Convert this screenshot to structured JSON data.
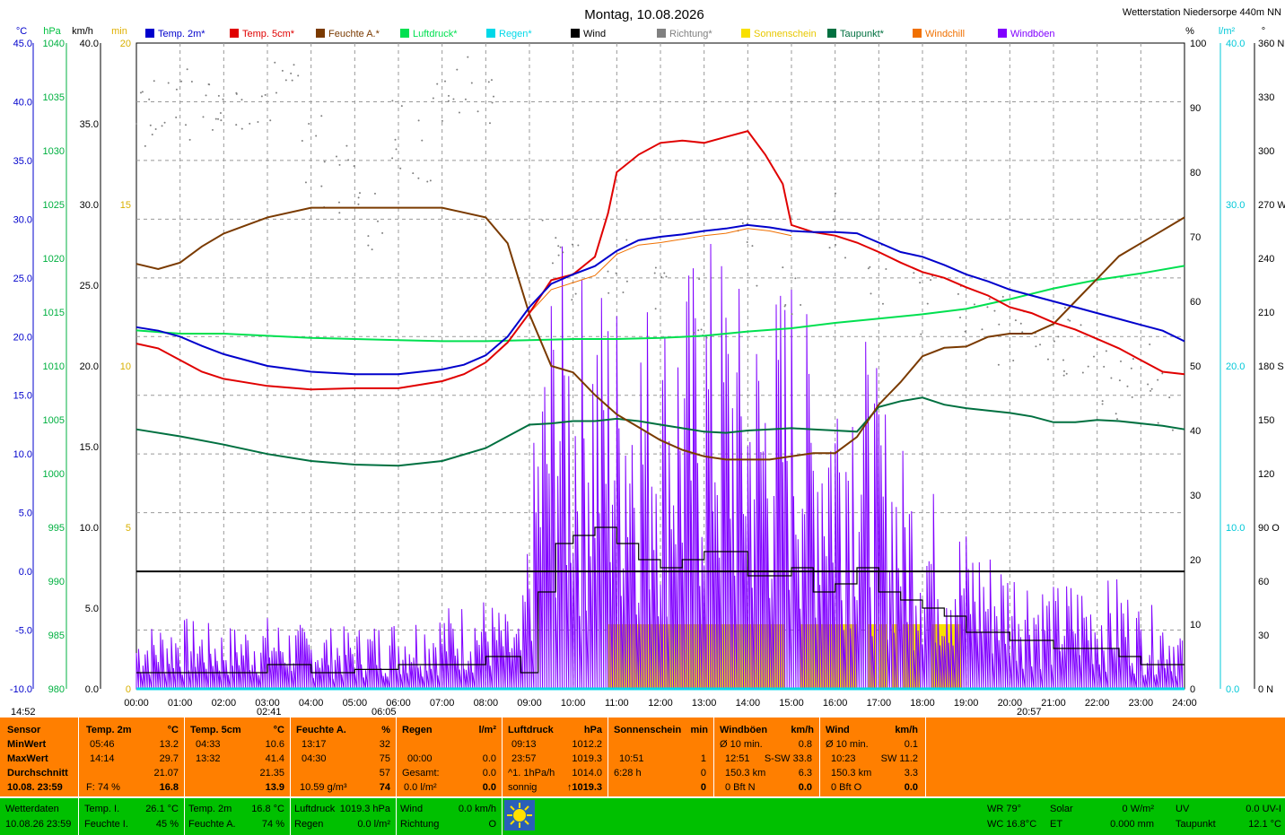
{
  "window": {
    "title": "Montag, 10.08.2026",
    "station": "Wetterstation Niedersorpe 440m NN"
  },
  "axis_units": {
    "temp": "°C",
    "hpa": "hPa",
    "kmh": "km/h",
    "min": "min",
    "pct": "%",
    "lm2": "l/m²",
    "deg": "°"
  },
  "legend": [
    {
      "label": "Temp. 2m*",
      "color": "#0000cc"
    },
    {
      "label": "Temp. 5cm*",
      "color": "#e00000"
    },
    {
      "label": "Feuchte A.*",
      "color": "#7a3a00"
    },
    {
      "label": "Luftdruck*",
      "color": "#00e050"
    },
    {
      "label": "Regen*",
      "color": "#00d8e8"
    },
    {
      "label": "Wind",
      "color": "#000000"
    },
    {
      "label": "Richtung*",
      "color": "#808080"
    },
    {
      "label": "Sonnenschein",
      "color": "#f8e000"
    },
    {
      "label": "Taupunkt*",
      "color": "#007040"
    },
    {
      "label": "Windchill",
      "color": "#f07000"
    },
    {
      "label": "Windböen",
      "color": "#8000ff"
    }
  ],
  "chart_data": {
    "type": "line",
    "title": "Montag, 10.08.2026",
    "x_ticks": [
      "00:00",
      "01:00",
      "02:00",
      "03:00",
      "04:00",
      "05:00",
      "06:00",
      "07:00",
      "08:00",
      "09:00",
      "10:00",
      "11:00",
      "12:00",
      "13:00",
      "14:00",
      "15:00",
      "16:00",
      "17:00",
      "18:00",
      "19:00",
      "20:00",
      "21:00",
      "22:00",
      "23:00",
      "24:00"
    ],
    "x_range_hours": [
      0,
      24
    ],
    "axes": {
      "temp_c": {
        "range": [
          -10,
          45
        ],
        "ticks": [
          "45.0",
          "40.0",
          "35.0",
          "30.0",
          "25.0",
          "20.0",
          "15.0",
          "10.0",
          "5.0",
          "0.0",
          "-5.0",
          "-10.0"
        ]
      },
      "pressure_hpa": {
        "range": [
          980,
          1040
        ],
        "ticks": [
          "1040",
          "1035",
          "1030",
          "1025",
          "1020",
          "1015",
          "1010",
          "1005",
          "1000",
          "995",
          "990",
          "985",
          "980"
        ]
      },
      "wind_kmh": {
        "range": [
          0,
          40
        ],
        "ticks": [
          "40.0",
          "35.0",
          "30.0",
          "25.0",
          "20.0",
          "15.0",
          "10.0",
          "5.0",
          "0.0"
        ]
      },
      "sun_min": {
        "range": [
          0,
          20
        ],
        "ticks": [
          "20",
          "15",
          "10",
          "5",
          "0"
        ]
      },
      "humidity_pct": {
        "range": [
          0,
          100
        ],
        "ticks": [
          "100",
          "90",
          "80",
          "70",
          "60",
          "50",
          "40",
          "30",
          "20",
          "10",
          "0"
        ]
      },
      "rain_lm2": {
        "range": [
          0,
          40
        ],
        "ticks": [
          "40.0",
          "30.0",
          "20.0",
          "10.0",
          "0.0"
        ]
      },
      "direction_deg": {
        "range": [
          0,
          360
        ],
        "ticks": [
          "360 N",
          "330",
          "300",
          "270 W",
          "240",
          "210",
          "180 S",
          "150",
          "120",
          "90 O",
          "60",
          "30",
          "0 N"
        ]
      }
    },
    "grid": true,
    "legend_position": "top",
    "series": [
      {
        "name": "Temp. 2m*",
        "axis": "temp_c",
        "x": [
          0,
          0.5,
          1,
          1.5,
          2,
          3,
          4,
          5,
          6,
          7,
          7.5,
          8,
          8.5,
          9,
          9.5,
          10,
          10.5,
          11,
          11.5,
          12,
          12.5,
          13,
          13.5,
          14,
          14.5,
          15,
          15.5,
          16,
          16.5,
          17,
          17.5,
          18,
          18.5,
          19,
          19.5,
          20,
          20.5,
          21,
          21.5,
          22,
          22.5,
          23,
          23.5,
          24
        ],
        "y": [
          20.8,
          20.5,
          20.0,
          19.2,
          18.5,
          17.5,
          17.0,
          16.8,
          16.8,
          17.2,
          17.6,
          18.4,
          20.0,
          22.5,
          24.5,
          25.3,
          26.0,
          27.3,
          28.2,
          28.5,
          28.7,
          29.0,
          29.2,
          29.5,
          29.3,
          29.0,
          28.9,
          28.9,
          28.8,
          28.0,
          27.2,
          26.8,
          26.1,
          25.3,
          24.7,
          24.0,
          23.5,
          23.0,
          22.5,
          22.0,
          21.5,
          21.0,
          20.5,
          19.6
        ]
      },
      {
        "name": "Temp. 5cm*",
        "axis": "temp_c",
        "x": [
          0,
          0.5,
          1,
          1.5,
          2,
          3,
          4,
          5,
          6,
          7,
          7.5,
          8,
          8.5,
          9,
          9.5,
          10,
          10.5,
          10.8,
          11,
          11.5,
          12,
          12.5,
          13,
          13.5,
          14,
          14.4,
          14.8,
          15,
          15.5,
          16,
          16.5,
          17,
          17.5,
          18,
          18.5,
          19,
          19.5,
          20,
          20.5,
          21,
          21.5,
          22,
          22.5,
          23,
          23.5,
          24
        ],
        "y": [
          19.4,
          19.0,
          18.0,
          17.0,
          16.4,
          15.8,
          15.5,
          15.6,
          15.6,
          16.2,
          16.8,
          17.8,
          19.5,
          22.0,
          24.8,
          25.3,
          26.8,
          30.5,
          34.0,
          35.5,
          36.5,
          36.7,
          36.5,
          37.0,
          37.5,
          35.5,
          33.0,
          29.5,
          28.9,
          28.6,
          28.0,
          27.2,
          26.3,
          25.5,
          25.0,
          24.2,
          23.5,
          22.5,
          22.0,
          21.2,
          20.6,
          19.8,
          19.0,
          18.0,
          17.0,
          16.8
        ]
      },
      {
        "name": "Feuchte A.*",
        "axis": "humidity_pct",
        "x": [
          0,
          0.5,
          1,
          1.5,
          2,
          3,
          4,
          5,
          6,
          7,
          8,
          8.5,
          9,
          9.5,
          10,
          10.5,
          11,
          11.5,
          12,
          12.5,
          13,
          13.5,
          14,
          14.5,
          15,
          15.5,
          16,
          16.5,
          17,
          17.5,
          18,
          18.5,
          19,
          19.5,
          20,
          20.5,
          21,
          21.5,
          22,
          22.5,
          23,
          23.5,
          24
        ],
        "y": [
          65.8,
          65.0,
          66.0,
          68.5,
          70.5,
          73.0,
          74.5,
          74.5,
          74.5,
          74.5,
          73.0,
          69.0,
          58.0,
          50.0,
          49.0,
          45.5,
          42.5,
          40.5,
          38.5,
          37.0,
          36.0,
          35.5,
          35.5,
          35.5,
          36.0,
          36.5,
          36.5,
          39.0,
          44.0,
          47.5,
          51.5,
          52.8,
          53.0,
          54.5,
          55.0,
          55.0,
          56.5,
          60.0,
          63.5,
          67.0,
          69.0,
          71.0,
          73.0
        ]
      },
      {
        "name": "Luftdruck*",
        "axis": "pressure_hpa",
        "x": [
          0,
          1,
          2,
          3,
          4,
          5,
          6,
          7,
          8,
          9,
          10,
          11,
          12,
          13,
          14,
          15,
          16,
          17,
          18,
          19,
          20,
          21,
          22,
          23,
          24
        ],
        "y": [
          1013.3,
          1013.0,
          1013.0,
          1012.8,
          1012.6,
          1012.5,
          1012.4,
          1012.3,
          1012.3,
          1012.4,
          1012.5,
          1012.5,
          1012.6,
          1012.8,
          1013.2,
          1013.5,
          1014.0,
          1014.4,
          1014.8,
          1015.3,
          1016.2,
          1017.2,
          1018.0,
          1018.6,
          1019.3
        ]
      },
      {
        "name": "Taupunkt*",
        "axis": "temp_c",
        "x": [
          0,
          1,
          2,
          3,
          4,
          5,
          6,
          7,
          8,
          8.5,
          9,
          9.5,
          10,
          10.5,
          11,
          11.5,
          12,
          12.5,
          13,
          13.5,
          14,
          14.5,
          15,
          15.5,
          16,
          16.5,
          17,
          17.5,
          18,
          18.5,
          19,
          19.5,
          20,
          20.5,
          21,
          21.5,
          22,
          22.5,
          23,
          23.5,
          24
        ],
        "y": [
          12.1,
          11.5,
          10.8,
          10.0,
          9.4,
          9.1,
          9.0,
          9.4,
          10.5,
          11.5,
          12.5,
          12.6,
          12.8,
          12.8,
          13.0,
          12.8,
          12.5,
          12.2,
          11.9,
          11.8,
          12.0,
          12.1,
          12.2,
          12.1,
          12.0,
          11.9,
          14.0,
          14.5,
          14.8,
          14.2,
          13.9,
          13.7,
          13.5,
          13.2,
          12.7,
          12.7,
          12.9,
          12.8,
          12.6,
          12.4,
          12.1
        ]
      },
      {
        "name": "Windchill",
        "axis": "temp_c",
        "x": [
          9,
          9.5,
          10,
          10.5,
          11,
          11.5,
          12,
          12.5,
          13,
          13.5,
          14,
          14.5,
          15
        ],
        "y": [
          22.0,
          24.0,
          24.6,
          25.2,
          27.0,
          27.8,
          28.0,
          28.3,
          28.6,
          28.8,
          29.2,
          29.0,
          28.6
        ]
      },
      {
        "name": "Wind",
        "axis": "wind_kmh",
        "x": [
          0,
          1,
          2,
          3,
          4,
          5,
          6,
          7,
          8,
          8.8,
          9.2,
          9.6,
          10,
          10.5,
          11,
          11.5,
          12,
          12.5,
          13,
          13.5,
          14,
          14.5,
          15,
          15.5,
          16,
          16.5,
          17,
          17.5,
          18,
          18.5,
          19,
          19.5,
          20,
          20.5,
          21,
          21.5,
          22,
          22.5,
          23,
          23.5,
          24
        ],
        "y": [
          1.0,
          1.0,
          1.0,
          1.5,
          1.0,
          1.2,
          1.5,
          1.5,
          2.0,
          1.0,
          6.0,
          9.0,
          9.5,
          10.0,
          9.0,
          8.0,
          7.5,
          8.0,
          8.5,
          8.5,
          7.0,
          7.0,
          7.5,
          6.0,
          6.5,
          7.5,
          6.0,
          5.5,
          5.0,
          4.5,
          3.5,
          3.5,
          3.0,
          3.0,
          2.5,
          2.5,
          2.5,
          2.0,
          1.5,
          1.5,
          1.5
        ]
      },
      {
        "name": "Windböen",
        "axis": "wind_kmh",
        "x": [
          0,
          1,
          2,
          3,
          4,
          5,
          6,
          7,
          8,
          8.8,
          9.2,
          9.6,
          10,
          10.5,
          11,
          11.5,
          12,
          12.5,
          13,
          13.5,
          14,
          14.5,
          15,
          15.5,
          16,
          16.5,
          17,
          17.5,
          18,
          18.5,
          19,
          19.5,
          20,
          20.5,
          21,
          21.5,
          22,
          22.5,
          23,
          23.5,
          24
        ],
        "y": [
          3.0,
          3.5,
          3.0,
          3.5,
          3.0,
          3.0,
          3.5,
          4.0,
          4.5,
          3.0,
          15.0,
          22.0,
          20.0,
          20.5,
          19.5,
          20.0,
          19.0,
          20.0,
          22.0,
          21.5,
          18.5,
          19.0,
          21.0,
          17.0,
          18.0,
          18.5,
          15.0,
          12.0,
          10.5,
          9.0,
          8.0,
          7.0,
          6.5,
          6.0,
          5.0,
          5.5,
          5.0,
          5.5,
          4.0,
          4.0,
          3.0
        ]
      },
      {
        "name": "Richtung*",
        "axis": "direction_deg",
        "x": [
          0.1,
          0.5,
          1,
          1.5,
          2,
          2.5,
          3,
          3.5,
          4,
          4.5,
          5,
          5.5,
          6,
          6.5,
          7,
          7.5,
          8,
          9.5,
          10,
          11,
          12,
          13,
          14,
          15,
          16,
          17,
          18,
          19,
          19.5,
          20,
          20.5,
          21,
          21.5,
          22,
          22.5,
          23,
          23.5
        ],
        "y": [
          322,
          322,
          326,
          327,
          331,
          328,
          331,
          333,
          300,
          280,
          290,
          260,
          310,
          300,
          320,
          335,
          330,
          250,
          230,
          240,
          230,
          210,
          240,
          220,
          260,
          230,
          215,
          210,
          200,
          200,
          210,
          180,
          195,
          170,
          170,
          180,
          160
        ]
      },
      {
        "name": "Regen*",
        "axis": "rain_lm2",
        "x": [
          0,
          24
        ],
        "y": [
          0,
          0
        ]
      }
    ],
    "sunshine_blocks_hours": [
      [
        10.8,
        14.85
      ],
      [
        15.2,
        16.5
      ],
      [
        16.75,
        16.95
      ],
      [
        17.0,
        17.2
      ],
      [
        17.3,
        17.45
      ],
      [
        17.55,
        17.95
      ],
      [
        18.2,
        18.9
      ]
    ],
    "markers": {
      "sunrise": "06:05",
      "sunset": "20:57",
      "min_time": "02:41",
      "start": "14:52"
    }
  },
  "panel": {
    "sensor": {
      "head": "Sensor",
      "rows": [
        "MinWert",
        "MaxWert",
        "Durchschnitt"
      ],
      "date": "10.08. 23:59"
    },
    "temp2m": {
      "head": "Temp. 2m",
      "unit": "°C",
      "min_t": "05:46",
      "min_v": "13.2",
      "max_t": "14:14",
      "max_v": "29.7",
      "avg": "21.07",
      "f_label": "F: 74 %",
      "cur": "16.8"
    },
    "temp5cm": {
      "head": "Temp. 5cm",
      "unit": "°C",
      "min_t": "04:33",
      "min_v": "10.6",
      "max_t": "13:32",
      "max_v": "41.4",
      "avg": "21.35",
      "cur": "13.9"
    },
    "feuchte": {
      "head": "Feuchte A.",
      "unit": "%",
      "min_t": "13:17",
      "min_v": "32",
      "max_t": "04:30",
      "max_v": "75",
      "avg": "57",
      "abs": "10.59 g/m³",
      "cur": "74"
    },
    "regen": {
      "head": "Regen",
      "unit": "l/m²",
      "t1": "00:00",
      "v1": "0.0",
      "g_label": "Gesamt:",
      "g": "0.0",
      "cur_label": "0.0 l/m²",
      "cur": "0.0"
    },
    "luftdruck": {
      "head": "Luftdruck",
      "unit": "hPa",
      "min_t": "09:13",
      "min_v": "1012.2",
      "max_t": "23:57",
      "max_v": "1019.3",
      "trend_l": "^1. 1hPa/h",
      "trend_v": "1014.0",
      "state": "sonnig",
      "cur": "↑1019.3"
    },
    "sonne": {
      "head": "Sonnenschein",
      "unit": "min",
      "t1": "10:51",
      "v1": "1",
      "t2": "6:28 h",
      "v2": "0",
      "cur": "0"
    },
    "boeen": {
      "head": "Windböen",
      "unit": "km/h",
      "r1l": "Ø 10 min.",
      "r1v": "0.8",
      "r2l": "12:51",
      "r2m": "S-SW 33.8",
      "r3l": "150.3 km",
      "r3v": "6.3",
      "r4l": "0 Bft N",
      "r4v": "0.0"
    },
    "wind": {
      "head": "Wind",
      "unit": "km/h",
      "r1l": "Ø 10 min.",
      "r1v": "0.1",
      "r2l": "10:23",
      "r2m": "SW 11.2",
      "r3l": "150.3 km",
      "r3v": "3.3",
      "r4l": "0 Bft O",
      "r4v": "0.0"
    }
  },
  "bottom": {
    "wd": {
      "l1": "Wetterdaten",
      "l2": "10.08.26 23:59"
    },
    "ti": {
      "l1": "Temp. I.",
      "v1": "26.1 °C",
      "l2": "Feuchte I.",
      "v2": "45 %"
    },
    "ta": {
      "l1": "Temp. 2m",
      "v1": "16.8 °C",
      "l2": "Feuchte A.",
      "v2": "74 %"
    },
    "ld": {
      "l1": "Luftdruck",
      "v1": "1019.3 hPa",
      "l2": "Regen",
      "v2": "0.0 l/m²"
    },
    "wi": {
      "l1": "Wind",
      "v1": "0.0 km/h",
      "l2": "Richtung",
      "v2": "O"
    },
    "wr": {
      "l1": "WR 79°",
      "l2": "WC 16.8°C"
    },
    "solar": {
      "l1": "Solar",
      "v1": "0 W/m²",
      "l2": "ET",
      "v2": "0.000 mm"
    },
    "uv": {
      "l1": "UV",
      "v1": "0.0 UV-I",
      "l2": "Taupunkt",
      "v2": "12.1 °C"
    }
  }
}
